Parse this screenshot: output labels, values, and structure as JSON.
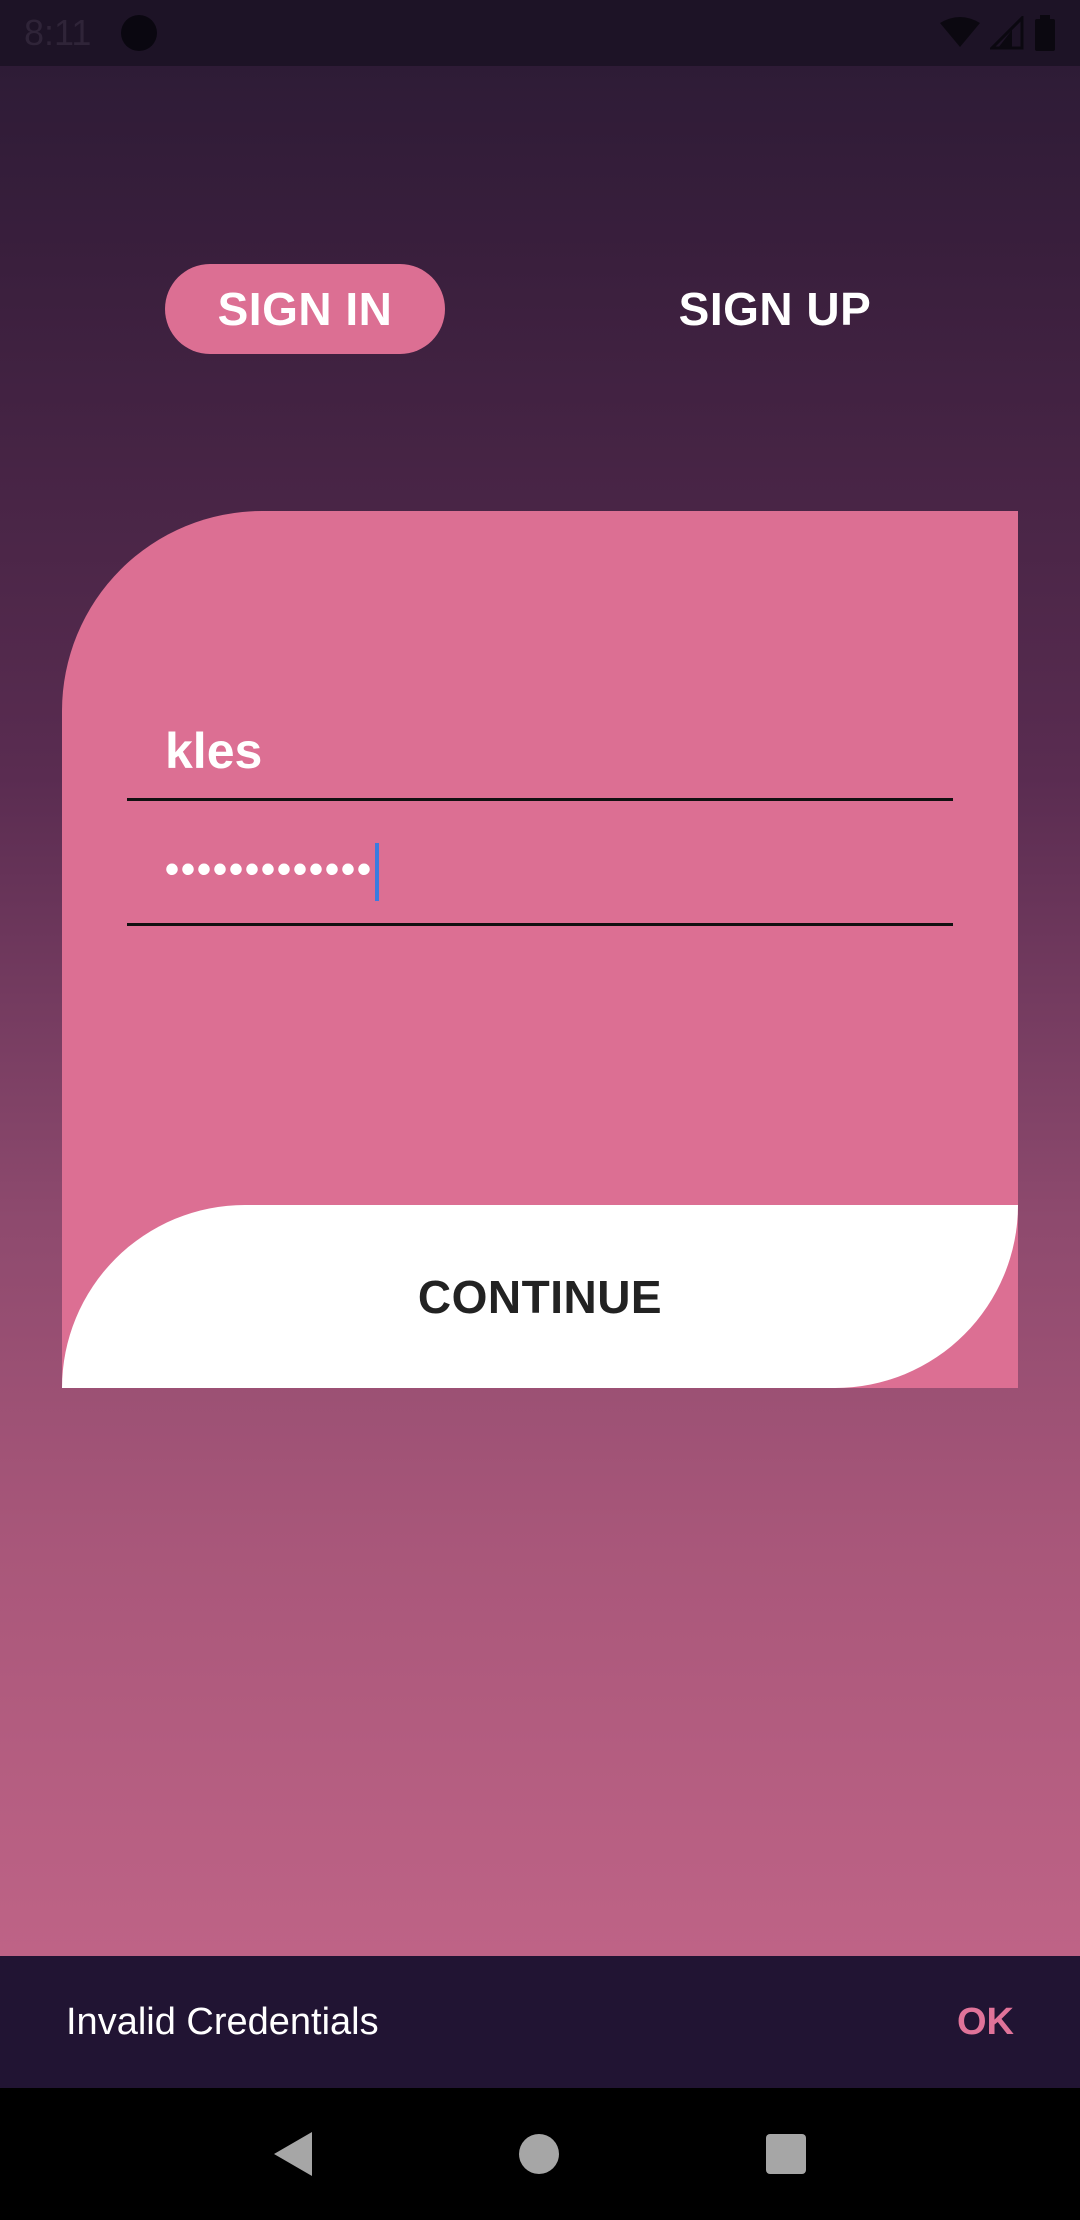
{
  "status_bar": {
    "time": "8:11",
    "icons": [
      "app-icon",
      "wifi-icon",
      "cell-signal-icon",
      "battery-icon"
    ]
  },
  "auth_tabs": {
    "sign_in": "SIGN IN",
    "sign_up": "SIGN UP",
    "active": "sign_in"
  },
  "form": {
    "username_value": "kles",
    "password_value": "•••••••••••••"
  },
  "continue_label": "CONTINUE",
  "snackbar": {
    "message": "Invalid Credentials",
    "action": "OK"
  },
  "colors": {
    "accent": "#dc6f93",
    "snackbar_bg": "#211433",
    "cursor": "#3b7be0"
  }
}
